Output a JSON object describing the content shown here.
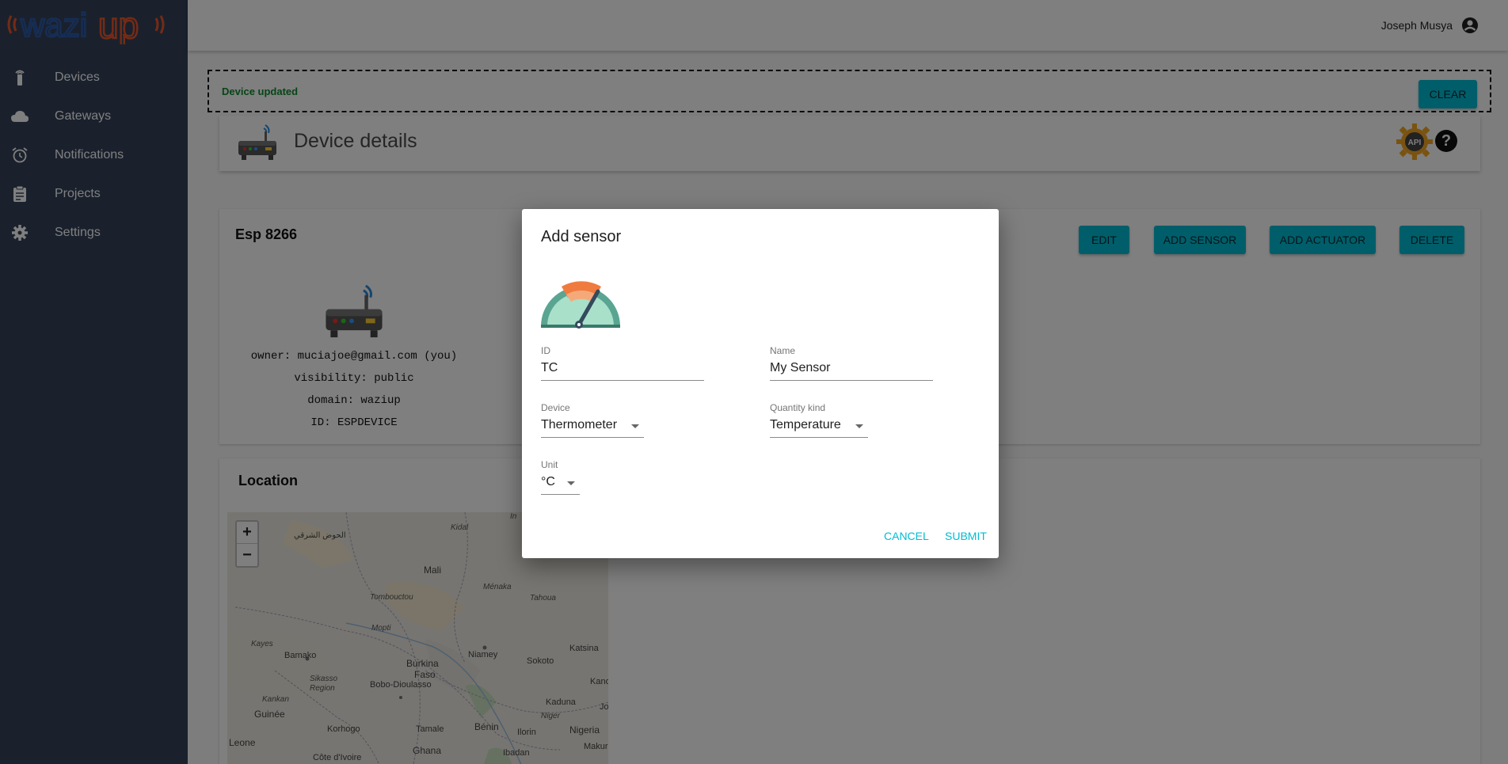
{
  "brand": {
    "logo_text": "wazi",
    "logo_suffix": "up"
  },
  "sidebar": {
    "items": [
      {
        "label": "Devices",
        "icon": "sensor-icon"
      },
      {
        "label": "Gateways",
        "icon": "cloud-icon"
      },
      {
        "label": "Notifications",
        "icon": "alarm-icon"
      },
      {
        "label": "Projects",
        "icon": "clipboard-icon"
      },
      {
        "label": "Settings",
        "icon": "gear-icon"
      }
    ]
  },
  "header": {
    "user_name": "Joseph Musya"
  },
  "notification": {
    "message": "Device updated",
    "clear_label": "CLEAR"
  },
  "page": {
    "title": "Device details",
    "api_label": "API",
    "help_label": "?"
  },
  "device": {
    "name": "Esp 8266",
    "owner": "owner: muciajoe@gmail.com (you)",
    "visibility": "visibility: public",
    "domain": "domain: waziup",
    "id": "ID: ESPDEVICE",
    "actions": {
      "edit": "EDIT",
      "add_sensor": "ADD SENSOR",
      "add_actuator": "ADD ACTUATOR",
      "delete": "DELETE"
    }
  },
  "location": {
    "title": "Location",
    "zoom_in": "+",
    "zoom_out": "−",
    "map_labels": {
      "hawd": "الحوض الشرقي",
      "kidal": "Kidal",
      "in": "In",
      "mali": "Mali",
      "tombouctou": "Tombouctou",
      "menaka": "Ménaka",
      "tahoua": "Tahoua",
      "mopti": "Mopti",
      "kayes": "Kayes",
      "bamako": "Bamako",
      "niamey": "Niamey",
      "sokoto": "Sokoto",
      "katsina": "Katsina",
      "burkina": "Burkina",
      "faso": "Faso",
      "sikasso": "Sikasso",
      "region": "Region",
      "bobo": "Bobo-Dioulasso",
      "kankan": "Kankan",
      "kaduna": "Kaduna",
      "kano": "Kano",
      "guinee": "Guinée",
      "benin": "Bénin",
      "niger": "Niger",
      "jos": "Jo",
      "korhogo": "Korhogo",
      "tamale": "Tamale",
      "ilorin": "Ilorin",
      "nigeria": "Nigeria",
      "leone": "Leone",
      "ghana": "Ghana",
      "makurdi": "Makur",
      "ibadan": "Ibadan",
      "cote": "Côte d'Ivoire"
    }
  },
  "dialog": {
    "title": "Add sensor",
    "fields": {
      "id": {
        "label": "ID",
        "value": "TC"
      },
      "name": {
        "label": "Name",
        "value": "My Sensor"
      },
      "device": {
        "label": "Device",
        "value": "Thermometer"
      },
      "quantity_kind": {
        "label": "Quantity kind",
        "value": "Temperature"
      },
      "unit": {
        "label": "Unit",
        "value": "°C"
      }
    },
    "cancel_label": "CANCEL",
    "submit_label": "SUBMIT"
  },
  "colors": {
    "accent": "#00bcd4",
    "sidebar": "#34425a",
    "success": "#0f8a2e",
    "logo_orange": "#e8562a",
    "logo_blue": "#2d5aa8"
  }
}
